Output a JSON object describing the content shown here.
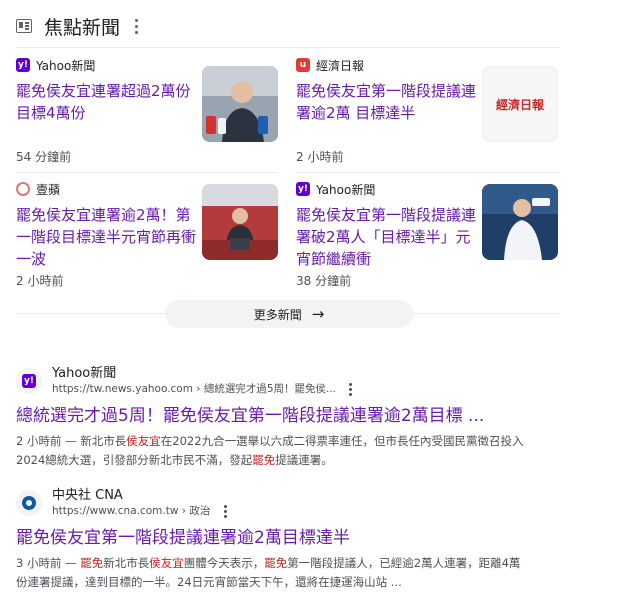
{
  "header": {
    "title": "焦點新聞"
  },
  "top_stories": [
    {
      "source": "Yahoo新聞",
      "title": "罷免侯友宜連署超過2萬份目標4萬份",
      "time": "54 分鐘前"
    },
    {
      "source": "經濟日報",
      "title": "罷免侯友宜第一階段提議連署逾2萬 目標達半",
      "time": "2 小時前",
      "thumb_text": "經濟日報"
    },
    {
      "source": "壹蘋",
      "title": "罷免侯友宜連署逾2萬！第一階段目標達半元宵節再衝一波",
      "time": "2 小時前"
    },
    {
      "source": "Yahoo新聞",
      "title": "罷免侯友宜第一階段提議連署破2萬人「目標達半」元宵節繼續衝",
      "time": "38 分鐘前"
    }
  ],
  "more_news": {
    "label": "更多新聞"
  },
  "results": [
    {
      "site_name": "Yahoo新聞",
      "url": "https://tw.news.yahoo.com › 總統選完才過5周！罷免侯...",
      "title": "總統選完才過5周！罷免侯友宜第一階段提議連署逾2萬目標 ...",
      "snippet": [
        {
          "t": "2 小時前 — 新北市長",
          "h": false
        },
        {
          "t": "侯友宜",
          "h": true
        },
        {
          "t": "在2022九合一選舉以六成二得票率連任，但市長任內受國民黨徵召投入2024總統大選，引發部分新北市民不滿，發起",
          "h": false
        },
        {
          "t": "罷免",
          "h": true
        },
        {
          "t": "提議連署。",
          "h": false
        }
      ]
    },
    {
      "site_name": "中央社 CNA",
      "url": "https://www.cna.com.tw › 政治",
      "title": "罷免侯友宜第一階段提議連署逾2萬目標達半",
      "snippet": [
        {
          "t": "3 小時前 — ",
          "h": false
        },
        {
          "t": "罷免",
          "h": true
        },
        {
          "t": "新北市長",
          "h": false
        },
        {
          "t": "侯友宜",
          "h": true
        },
        {
          "t": "團體今天表示，",
          "h": false
        },
        {
          "t": "罷免",
          "h": true
        },
        {
          "t": "第一階段提議人，已經逾2萬人連署，距離4萬份連署提議，達到目標的一半。24日元宵節當天下午，還將在捷運海山站 ...",
          "h": false
        }
      ]
    }
  ],
  "colors": {
    "visited_link": "#681da8",
    "highlight": "#c5221f",
    "yahoo_purple": "#6001d2",
    "cna_blue": "#0b5aa5"
  },
  "icons": [
    "newspaper-icon",
    "more-vert-icon",
    "arrow-right-icon",
    "yahoo-logo",
    "udn-logo",
    "nextapple-logo",
    "cna-logo"
  ]
}
